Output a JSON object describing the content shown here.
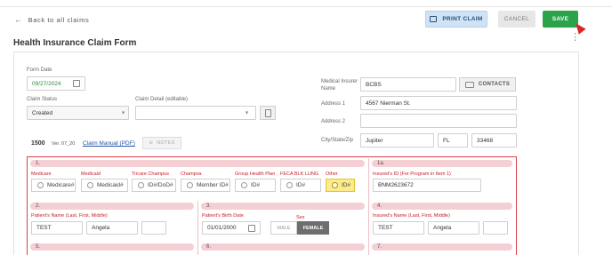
{
  "header": {
    "back_label": "Back to all claims",
    "print_label": "PRINT CLAIM",
    "cancel_label": "CANCEL",
    "save_label": "SAVE"
  },
  "page": {
    "title": "Health Insurance Claim Form"
  },
  "form": {
    "form_date_label": "Form Date",
    "form_date_value": "09/27/2024",
    "claim_status_label": "Claim Status",
    "claim_status_value": "Created",
    "claim_detail_label": "Claim Detail (editable)",
    "claim_detail_value": "",
    "form_number": "1500",
    "form_version": "Ver. 07_20",
    "claim_manual_label": "Claim Manual (PDF)",
    "notes_label": "NOTES",
    "insurer_name_label": "Medical Insurer Name",
    "insurer_name_value": "BCBS",
    "contacts_label": "CONTACTS",
    "address1_label": "Address 1",
    "address1_value": "4567 Nierman St.",
    "address2_label": "Address 2",
    "address2_value": "",
    "city_state_zip_label": "City/State/Zip",
    "city_value": "Jupiter",
    "state_value": "FL",
    "zip_value": "33468"
  },
  "grid": {
    "section1": {
      "number": "1.",
      "types": [
        {
          "label": "Medicare",
          "placeholder": "Medicare#",
          "selected": false
        },
        {
          "label": "Medicaid",
          "placeholder": "Medicaid#",
          "selected": false
        },
        {
          "label": "Tricare Champus",
          "placeholder": "ID#/DoD#",
          "selected": false
        },
        {
          "label": "Champva",
          "placeholder": "Member ID#",
          "selected": false
        },
        {
          "label": "Group Health Plan",
          "placeholder": "ID#",
          "selected": false
        },
        {
          "label": "FECA BLK LUNG",
          "placeholder": "ID#",
          "selected": false
        },
        {
          "label": "Other",
          "placeholder": "ID#",
          "selected": true
        }
      ]
    },
    "section1a": {
      "number": "1a.",
      "label": "Insured's ID (For Program in Item 1)",
      "value": "BNM2623672"
    },
    "section2": {
      "number": "2.",
      "label": "Patient's Name (Last, First, Middle)",
      "last": "TEST",
      "first": "Angela",
      "middle": ""
    },
    "section3": {
      "number": "3.",
      "birth_label": "Patient's Birth Date",
      "birth_value": "01/01/2000",
      "sex_label": "Sex",
      "male_label": "MALE",
      "female_label": "FEMALE",
      "selected_sex": "FEMALE"
    },
    "section4": {
      "number": "4.",
      "label": "Insured's Name (Last, First, Middle)",
      "last": "TEST",
      "first": "Angela",
      "middle": ""
    },
    "section5": {
      "number": "5."
    },
    "section6": {
      "number": "6."
    },
    "section7": {
      "number": "7."
    }
  },
  "colors": {
    "save": "#2aa34a",
    "print": "#cfe3f6",
    "accent_red": "#c8202b",
    "other_selected": "#fdeb8a"
  }
}
